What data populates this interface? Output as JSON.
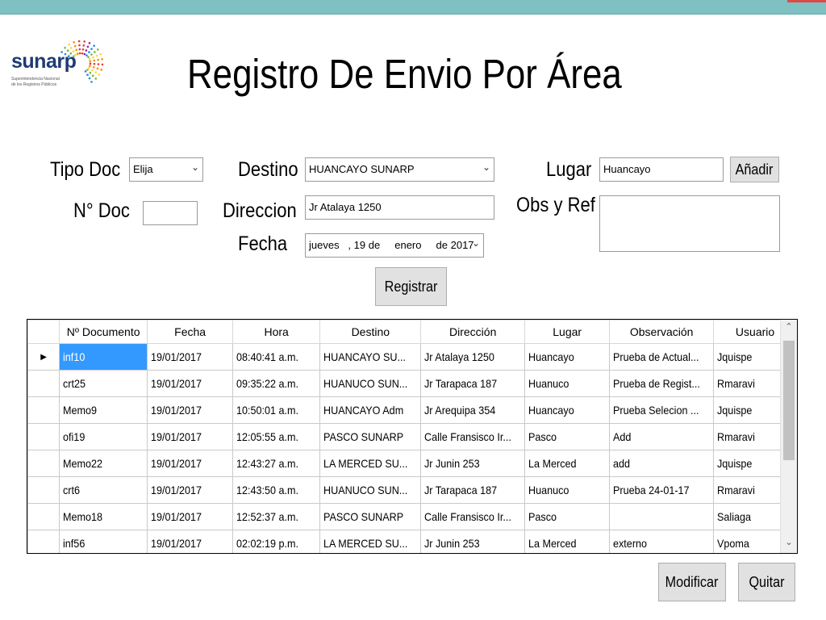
{
  "window": {
    "accent": "#7fc1c3"
  },
  "logo": {
    "text": "sunarp",
    "subtitle": "Superintendencia Nacional\nde los Registros Públicos"
  },
  "title": "Registro De Envio Por Área",
  "form": {
    "tipo_doc": {
      "label": "Tipo Doc",
      "value": "Elija"
    },
    "n_doc": {
      "label": "N° Doc",
      "value": ""
    },
    "destino": {
      "label": "Destino",
      "value": "HUANCAYO SUNARP"
    },
    "direccion": {
      "label": "Direccion",
      "value": "Jr Atalaya 1250"
    },
    "fecha": {
      "label": "Fecha",
      "value": "jueves   , 19 de     enero     de 2017"
    },
    "lugar": {
      "label": "Lugar",
      "value": "Huancayo"
    },
    "obs": {
      "label": "Obs y Ref",
      "value": ""
    },
    "add_button": "Añadir",
    "register_button": "Registrar"
  },
  "table": {
    "columns": [
      "Nº Documento",
      "Fecha",
      "Hora",
      "Destino",
      "Dirección",
      "Lugar",
      "Observación",
      "Usuario"
    ],
    "rows": [
      {
        "doc": "inf10",
        "fecha": "19/01/2017",
        "hora": "08:40:41 a.m.",
        "destino": "HUANCAYO SU...",
        "direccion": "Jr Atalaya 1250",
        "lugar": "Huancayo",
        "obs": "Prueba de Actual...",
        "usuario": "Jquispe",
        "selected": true
      },
      {
        "doc": "crt25",
        "fecha": "19/01/2017",
        "hora": "09:35:22 a.m.",
        "destino": "HUANUCO SUN...",
        "direccion": "Jr Tarapaca 187",
        "lugar": "Huanuco",
        "obs": "Prueba de Regist...",
        "usuario": "Rmaravi"
      },
      {
        "doc": "Memo9",
        "fecha": "19/01/2017",
        "hora": "10:50:01 a.m.",
        "destino": "HUANCAYO Adm",
        "direccion": "Jr Arequipa 354",
        "lugar": "Huancayo",
        "obs": "Prueba Selecion ...",
        "usuario": "Jquispe"
      },
      {
        "doc": "ofi19",
        "fecha": "19/01/2017",
        "hora": "12:05:55 a.m.",
        "destino": "PASCO SUNARP",
        "direccion": "Calle Fransisco Ir...",
        "lugar": "Pasco",
        "obs": "Add",
        "usuario": "Rmaravi"
      },
      {
        "doc": "Memo22",
        "fecha": "19/01/2017",
        "hora": "12:43:27 a.m.",
        "destino": "LA MERCED SU...",
        "direccion": "Jr Junin 253",
        "lugar": "La Merced",
        "obs": "add",
        "usuario": "Jquispe"
      },
      {
        "doc": "crt6",
        "fecha": "19/01/2017",
        "hora": "12:43:50 a.m.",
        "destino": "HUANUCO SUN...",
        "direccion": "Jr Tarapaca 187",
        "lugar": "Huanuco",
        "obs": "Prueba 24-01-17",
        "usuario": "Rmaravi"
      },
      {
        "doc": "Memo18",
        "fecha": "19/01/2017",
        "hora": "12:52:37 a.m.",
        "destino": "PASCO SUNARP",
        "direccion": "Calle Fransisco Ir...",
        "lugar": "Pasco",
        "obs": "",
        "usuario": "Saliaga"
      },
      {
        "doc": "inf56",
        "fecha": "19/01/2017",
        "hora": "02:02:19 p.m.",
        "destino": "LA MERCED SU...",
        "direccion": "Jr Junin 253",
        "lugar": "La Merced",
        "obs": "externo",
        "usuario": "Vpoma"
      }
    ]
  },
  "actions": {
    "modify": "Modificar",
    "quit": "Quitar"
  }
}
